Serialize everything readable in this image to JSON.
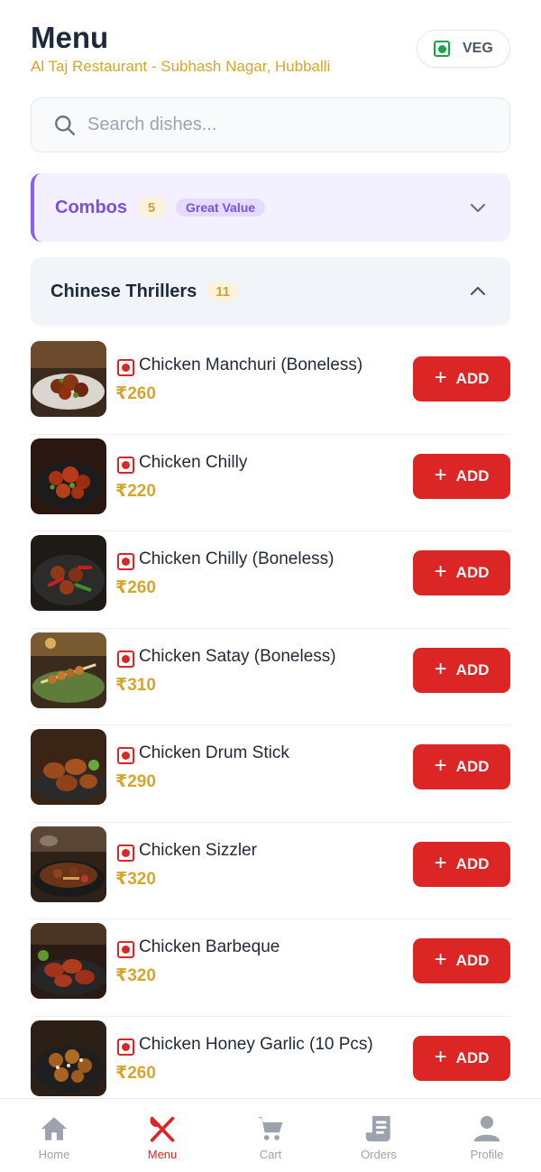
{
  "header": {
    "title": "Menu",
    "subtitle": "Al Taj Restaurant - Subhash Nagar, Hubballi",
    "veg_toggle_label": "VEG"
  },
  "search": {
    "placeholder": "Search dishes...",
    "value": ""
  },
  "sections": {
    "combos": {
      "title": "Combos",
      "count": "5",
      "tag": "Great Value",
      "expanded": false
    },
    "chinese": {
      "title": "Chinese Thrillers",
      "count": "11",
      "expanded": true
    }
  },
  "items": [
    {
      "name": "Chicken Manchuri (Boneless)",
      "price": "₹260",
      "add_label": "ADD"
    },
    {
      "name": "Chicken Chilly",
      "price": "₹220",
      "add_label": "ADD"
    },
    {
      "name": "Chicken Chilly (Boneless)",
      "price": "₹260",
      "add_label": "ADD"
    },
    {
      "name": "Chicken Satay (Boneless)",
      "price": "₹310",
      "add_label": "ADD"
    },
    {
      "name": "Chicken Drum Stick",
      "price": "₹290",
      "add_label": "ADD"
    },
    {
      "name": "Chicken Sizzler",
      "price": "₹320",
      "add_label": "ADD"
    },
    {
      "name": "Chicken Barbeque",
      "price": "₹320",
      "add_label": "ADD"
    },
    {
      "name": "Chicken Honey Garlic (10 Pcs)",
      "price": "₹260",
      "add_label": "ADD"
    }
  ],
  "nav": [
    {
      "label": "Home",
      "icon": "home-icon",
      "active": false
    },
    {
      "label": "Menu",
      "icon": "fork-knife-icon",
      "active": true
    },
    {
      "label": "Cart",
      "icon": "cart-icon",
      "active": false
    },
    {
      "label": "Orders",
      "icon": "receipt-icon",
      "active": false
    },
    {
      "label": "Profile",
      "icon": "user-icon",
      "active": false
    }
  ],
  "colors": {
    "brand_red": "#dc2626",
    "price_gold": "#d4a72c",
    "combo_purple": "#7c4fe0",
    "veg_green": "#16a34a"
  }
}
